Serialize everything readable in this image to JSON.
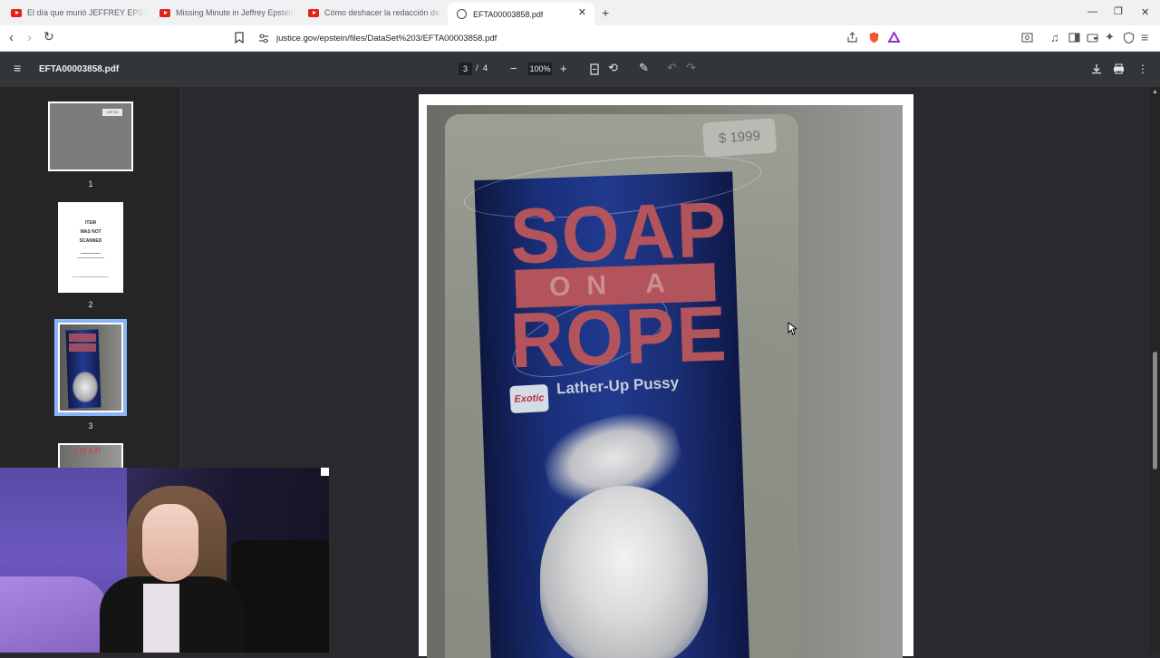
{
  "browser": {
    "tabs": [
      {
        "title": "El día que murió JEFFREY EPSTEIN - Y",
        "icon": "youtube-icon",
        "active": false
      },
      {
        "title": "Missing Minute in Jeffrey Epstein Jai",
        "icon": "youtube-icon",
        "active": false
      },
      {
        "title": "Cómo deshacer la redacción de los a",
        "icon": "youtube-icon",
        "active": false
      },
      {
        "title": "EFTA00003858.pdf",
        "icon": "globe-icon",
        "active": true
      }
    ],
    "new_tab": "+",
    "url": "justice.gov/epstein/files/DataSet%203/EFTA00003858.pdf",
    "accent_color": "#e0241c"
  },
  "pdf": {
    "file_name": "EFTA00003858.pdf",
    "current_page": "3",
    "page_separator": "/",
    "total_pages": "4",
    "zoom": "100%"
  },
  "thumbnails": [
    {
      "number": "1",
      "stamp": "LBT-03"
    },
    {
      "number": "2",
      "lines": [
        "ITEM",
        "WAS NOT",
        "SCANNED"
      ]
    },
    {
      "number": "3",
      "selected": true
    }
  ],
  "thumb4_text": "SOAP",
  "document": {
    "price_tag": "$ 1999",
    "headline_top": "SOAP",
    "headline_mid": "ON A",
    "headline_bottom": "ROPE",
    "brand": "Exotic",
    "subtitle": "Lather-Up Pussy"
  }
}
